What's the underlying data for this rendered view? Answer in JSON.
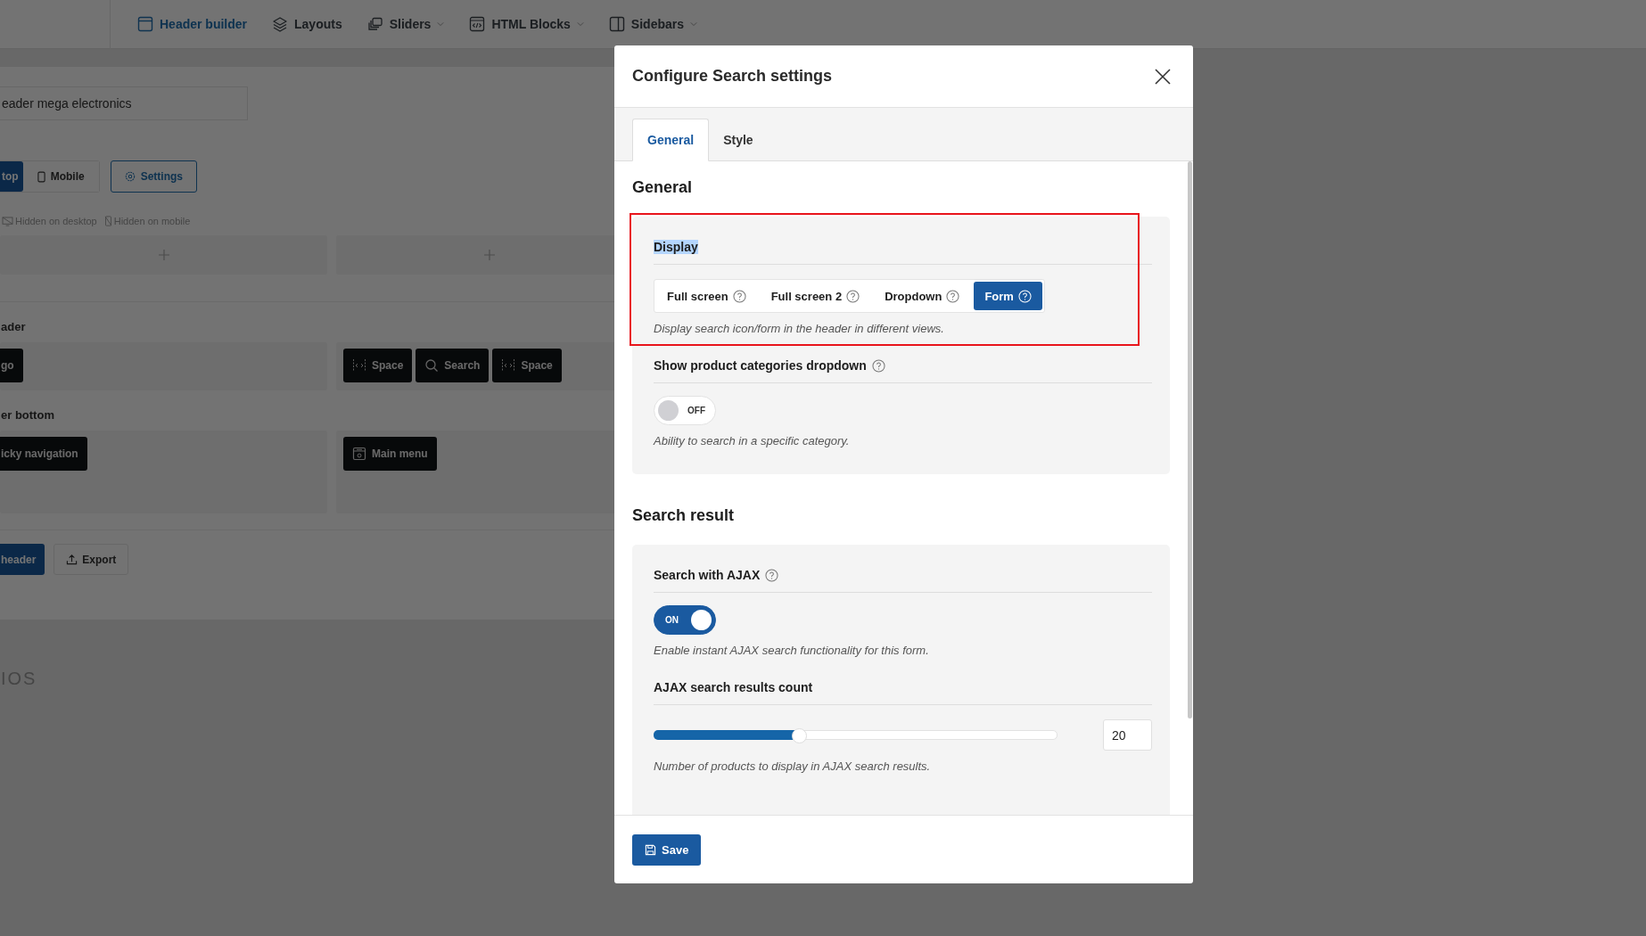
{
  "top_nav": {
    "items": [
      {
        "label": "Header builder",
        "selected": true,
        "dropdown": false
      },
      {
        "label": "Layouts",
        "selected": false,
        "dropdown": false
      },
      {
        "label": "Sliders",
        "selected": false,
        "dropdown": true
      },
      {
        "label": "HTML Blocks",
        "selected": false,
        "dropdown": true
      },
      {
        "label": "Sidebars",
        "selected": false,
        "dropdown": true
      }
    ]
  },
  "builder": {
    "header_name": "eader mega electronics",
    "device_tabs": [
      {
        "label": "top",
        "selected": true
      },
      {
        "label": "Mobile",
        "selected": false
      }
    ],
    "settings_button": "Settings",
    "legend": [
      "Hidden on desktop",
      "Hidden on mobile"
    ],
    "rows": [
      {
        "zones": [
          {
            "kind": "empty"
          },
          {
            "kind": "empty"
          }
        ]
      },
      {
        "title": "ader",
        "zones": [
          {
            "kind": "filled",
            "elements": [
              {
                "label": "go",
                "kind": "plain"
              }
            ]
          },
          {
            "kind": "filled",
            "elements": [
              {
                "label": "Space",
                "kind": "space"
              },
              {
                "label": "Search",
                "kind": "search"
              },
              {
                "label": "Space",
                "kind": "space"
              }
            ]
          }
        ]
      },
      {
        "title": "er bottom",
        "zones": [
          {
            "kind": "filled",
            "elements": [
              {
                "label": "icky navigation",
                "kind": "plain"
              }
            ]
          },
          {
            "kind": "filled",
            "elements": [
              {
                "label": "Main menu",
                "kind": "menu"
              }
            ]
          }
        ]
      }
    ],
    "actions": [
      {
        "label": "header",
        "primary": true
      },
      {
        "label": "Export",
        "primary": false
      }
    ],
    "footer_logo": "IOS"
  },
  "dialog": {
    "title": "Configure Search settings",
    "tabs": [
      {
        "label": "General",
        "selected": true
      },
      {
        "label": "Style",
        "selected": false
      }
    ],
    "sections": [
      {
        "heading": "General",
        "fields": [
          {
            "kind": "segmented",
            "label": "Display",
            "label_selected": true,
            "highlighted": true,
            "info": false,
            "options": [
              {
                "label": "Full screen",
                "selected": false
              },
              {
                "label": "Full screen 2",
                "selected": false
              },
              {
                "label": "Dropdown",
                "selected": false
              },
              {
                "label": "Form",
                "selected": true
              }
            ],
            "help": "Display search icon/form in the header in different views."
          },
          {
            "kind": "toggle",
            "label": "Show product categories dropdown",
            "info": true,
            "on": false,
            "state_text": "OFF",
            "help": "Ability to search in a specific category."
          }
        ]
      },
      {
        "heading": "Search result",
        "fields": [
          {
            "kind": "toggle",
            "label": "Search with AJAX",
            "info": true,
            "on": true,
            "state_text": "ON",
            "help": "Enable instant AJAX search functionality for this form."
          },
          {
            "kind": "slider",
            "label": "AJAX search results count",
            "info": false,
            "level": 0.36,
            "value": "20",
            "help": "Number of products to display in AJAX search results."
          }
        ]
      }
    ],
    "save_button": "Save"
  }
}
